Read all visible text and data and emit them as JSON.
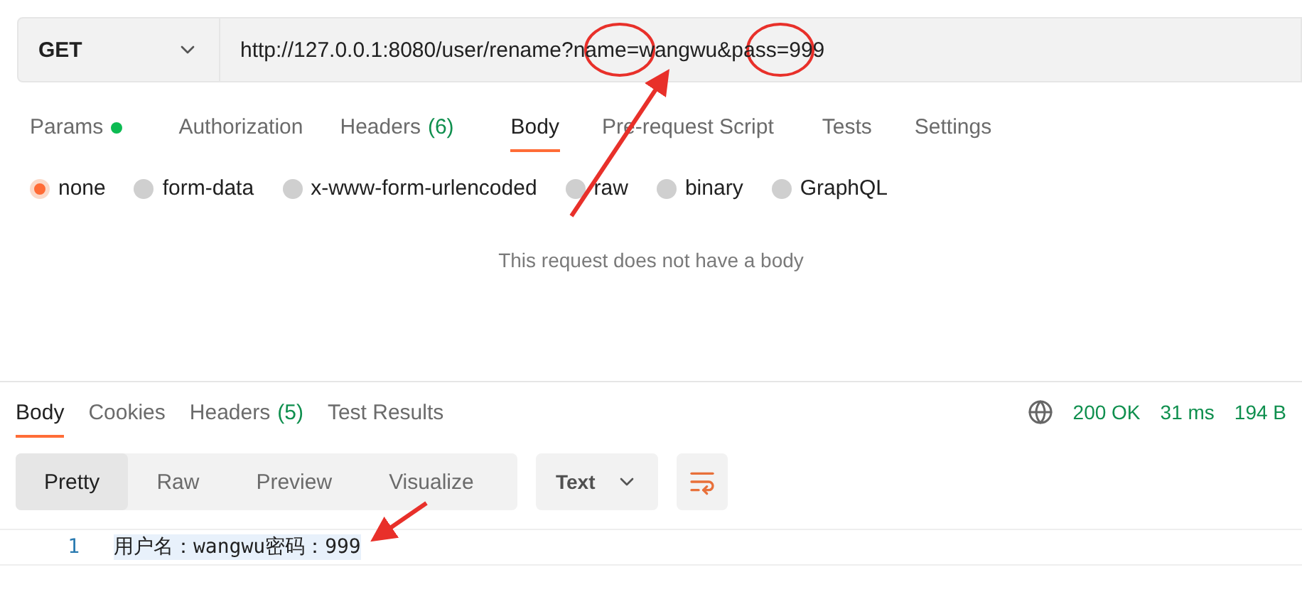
{
  "request": {
    "method": "GET",
    "url": "http://127.0.0.1:8080/user/rename?name=wangwu&pass=999"
  },
  "request_tabs": [
    {
      "label": "Params",
      "dot": true,
      "selected": false
    },
    {
      "label": "Authorization",
      "dot": false,
      "selected": false
    },
    {
      "label": "Headers",
      "dot": false,
      "count": "(6)",
      "selected": false
    },
    {
      "label": "Body",
      "dot": false,
      "selected": true
    },
    {
      "label": "Pre-request Script",
      "dot": false,
      "selected": false
    },
    {
      "label": "Tests",
      "dot": false,
      "selected": false
    },
    {
      "label": "Settings",
      "dot": false,
      "selected": false
    }
  ],
  "body_types": [
    {
      "label": "none",
      "selected": true
    },
    {
      "label": "form-data",
      "selected": false
    },
    {
      "label": "x-www-form-urlencoded",
      "selected": false
    },
    {
      "label": "raw",
      "selected": false
    },
    {
      "label": "binary",
      "selected": false
    },
    {
      "label": "GraphQL",
      "selected": false
    }
  ],
  "body_message": "This request does not have a body",
  "response_tabs": [
    {
      "label": "Body",
      "selected": true
    },
    {
      "label": "Cookies",
      "selected": false
    },
    {
      "label": "Headers",
      "count": "(5)",
      "selected": false
    },
    {
      "label": "Test Results",
      "selected": false
    }
  ],
  "status": {
    "code": "200 OK",
    "time": "31 ms",
    "size": "194 B"
  },
  "view_modes": [
    {
      "label": "Pretty",
      "selected": true
    },
    {
      "label": "Raw",
      "selected": false
    },
    {
      "label": "Preview",
      "selected": false
    },
    {
      "label": "Visualize",
      "selected": false
    }
  ],
  "format": "Text",
  "lines": [
    {
      "number": "1",
      "text": "用户名：wangwu密码：999"
    }
  ]
}
